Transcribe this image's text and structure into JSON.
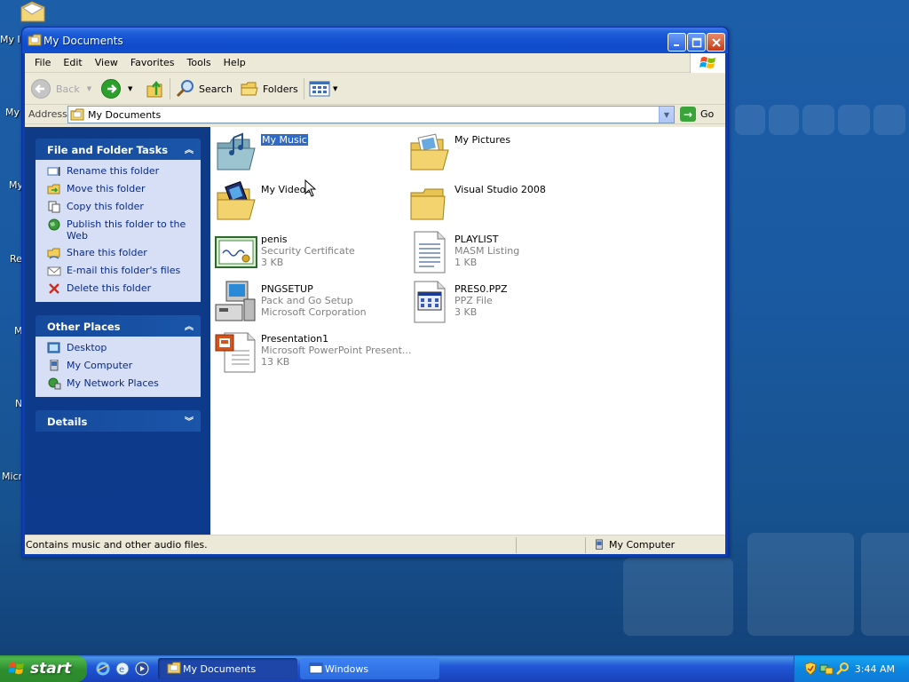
{
  "window": {
    "title": "My Documents",
    "controls": {
      "minimize": "_",
      "maximize": "□",
      "close": "✕"
    }
  },
  "menu": [
    "File",
    "Edit",
    "View",
    "Favorites",
    "Tools",
    "Help"
  ],
  "toolbar": {
    "back": "Back",
    "search": "Search",
    "folders": "Folders"
  },
  "address": {
    "label": "Address",
    "value": "My Documents",
    "go": "Go"
  },
  "taskpane": {
    "file_tasks": {
      "title": "File and Folder Tasks",
      "items": [
        "Rename this folder",
        "Move this folder",
        "Copy this folder",
        "Publish this folder to the Web",
        "Share this folder",
        "E-mail this folder's files",
        "Delete this folder"
      ]
    },
    "other_places": {
      "title": "Other Places",
      "items": [
        "Desktop",
        "My Computer",
        "My Network Places"
      ]
    },
    "details": {
      "title": "Details"
    }
  },
  "files": [
    {
      "name": "My Music",
      "sub1": "",
      "sub2": "",
      "icon": "music-folder-icon",
      "selected": true
    },
    {
      "name": "My Pictures",
      "sub1": "",
      "sub2": "",
      "icon": "pictures-folder-icon",
      "selected": false
    },
    {
      "name": "My Videos",
      "sub1": "",
      "sub2": "",
      "icon": "videos-folder-icon",
      "selected": false
    },
    {
      "name": "Visual Studio 2008",
      "sub1": "",
      "sub2": "",
      "icon": "folder-icon",
      "selected": false
    },
    {
      "name": "penis",
      "sub1": "Security Certificate",
      "sub2": "3 KB",
      "icon": "certificate-icon",
      "selected": false
    },
    {
      "name": "PLAYLIST",
      "sub1": "MASM Listing",
      "sub2": "1 KB",
      "icon": "text-file-icon",
      "selected": false
    },
    {
      "name": "PNGSETUP",
      "sub1": "Pack and Go Setup",
      "sub2": "Microsoft Corporation",
      "icon": "setup-icon",
      "selected": false
    },
    {
      "name": "PRES0.PPZ",
      "sub1": "PPZ File",
      "sub2": "3 KB",
      "icon": "ppz-file-icon",
      "selected": false
    },
    {
      "name": "Presentation1",
      "sub1": "Microsoft PowerPoint Present...",
      "sub2": "13 KB",
      "icon": "powerpoint-file-icon",
      "selected": false
    }
  ],
  "status": {
    "text": "Contains music and other audio files.",
    "location": "My Computer"
  },
  "desktop_icons": [
    "My I",
    "My",
    "My",
    "Re",
    "M",
    "N",
    "Micr"
  ],
  "taskbar": {
    "start": "start",
    "tasks": [
      {
        "label": "My Documents",
        "active": true
      },
      {
        "label": "Windows",
        "active": false
      }
    ],
    "clock": "3:44 AM"
  },
  "colors": {
    "taskpane_bg": "#0e3a86",
    "selection": "#316ac5",
    "link": "#0a2a8a"
  }
}
